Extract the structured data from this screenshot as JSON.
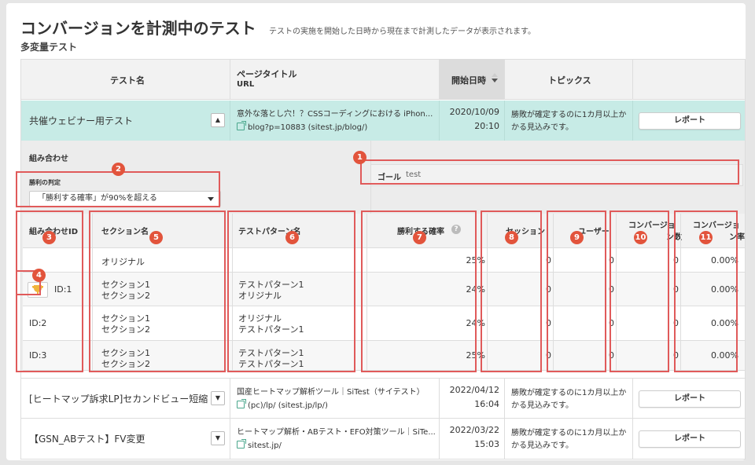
{
  "header": {
    "title": "コンバージョンを計測中のテスト",
    "description": "テストの実施を開始した日時から現在まで計測したデータが表示されます。",
    "subtitle": "多変量テスト"
  },
  "columns": {
    "test_name": "テスト名",
    "page_title": "ページタイトル",
    "url": "URL",
    "start_date": "開始日時",
    "topics": "トピックス"
  },
  "tests": [
    {
      "name": "共催ウェビナー用テスト",
      "page_title": "意外な落とし穴！？CSSコーディングにおける iPhon...",
      "url": "blog?p=10883 (sitest.jp/blog/)",
      "date": "2020/10/09",
      "time": "20:10",
      "topic_line1": "勝敗が確定するのに1カ月以上か",
      "topic_line2": "かる見込みです。",
      "report_label": "レポート",
      "toggle": "▲"
    },
    {
      "name": "[ヒートマップ訴求LP]セカンドビュー短縮",
      "page_title": "国産ヒートマップ解析ツール｜SiTest（サイテスト）",
      "url": "(pc)/lp/ (sitest.jp/lp/)",
      "date": "2022/04/12",
      "time": "16:04",
      "topic_line1": "勝敗が確定するのに1カ月以上か",
      "topic_line2": "かる見込みです。",
      "report_label": "レポート",
      "toggle": "▼"
    },
    {
      "name": "【GSN_ABテスト】FV変更",
      "page_title": "ヒートマップ解析・ABテスト・EFO対策ツール｜SiTe...",
      "url": "sitest.jp/",
      "date": "2022/03/22",
      "time": "15:03",
      "topic_line1": "勝敗が確定するのに1カ月以上か",
      "topic_line2": "かる見込みです。",
      "report_label": "レポート",
      "toggle": "▼"
    }
  ],
  "combination": {
    "label": "組み合わせ",
    "judge_label": "勝利の判定",
    "judge_value": "「勝利する確率」が90%を超える",
    "goal_label": "ゴール",
    "goal_value": "test"
  },
  "detail_headers": {
    "combo_id": "組み合わせID",
    "section": "セクション名",
    "pattern": "テストパターン名",
    "win_prob": "勝利する確率",
    "sessions": "セッション",
    "users": "ユーザー",
    "cv_line1": "コンバージョ",
    "cv_line2": "ン数",
    "cvr_line1": "コンバージョ",
    "cvr_line2": "ン率",
    "help": "?"
  },
  "detail_rows": [
    {
      "id": "",
      "section1": "オリジナル",
      "section2": "",
      "pattern1": "",
      "pattern2": "",
      "win": "25%",
      "sessions": "0",
      "users": "0",
      "cv": "0",
      "cvr": "0.00%"
    },
    {
      "id": "ID:1",
      "section1": "セクション1",
      "section2": "セクション2",
      "pattern1": "テストパターン1",
      "pattern2": "オリジナル",
      "win": "24%",
      "sessions": "0",
      "users": "0",
      "cv": "0",
      "cvr": "0.00%"
    },
    {
      "id": "ID:2",
      "section1": "セクション1",
      "section2": "セクション2",
      "pattern1": "オリジナル",
      "pattern2": "テストパターン1",
      "win": "24%",
      "sessions": "0",
      "users": "0",
      "cv": "0",
      "cvr": "0.00%"
    },
    {
      "id": "ID:3",
      "section1": "セクション1",
      "section2": "セクション2",
      "pattern1": "テストパターン1",
      "pattern2": "テストパターン1",
      "win": "25%",
      "sessions": "0",
      "users": "0",
      "cv": "0",
      "cvr": "0.00%"
    }
  ],
  "badges": [
    "1",
    "2",
    "3",
    "4",
    "5",
    "6",
    "7",
    "8",
    "9",
    "10",
    "11"
  ],
  "colors": {
    "highlight_row": "#c7ebe6",
    "annotation_red": "#e2543c",
    "link_icon": "#4aa78c"
  }
}
